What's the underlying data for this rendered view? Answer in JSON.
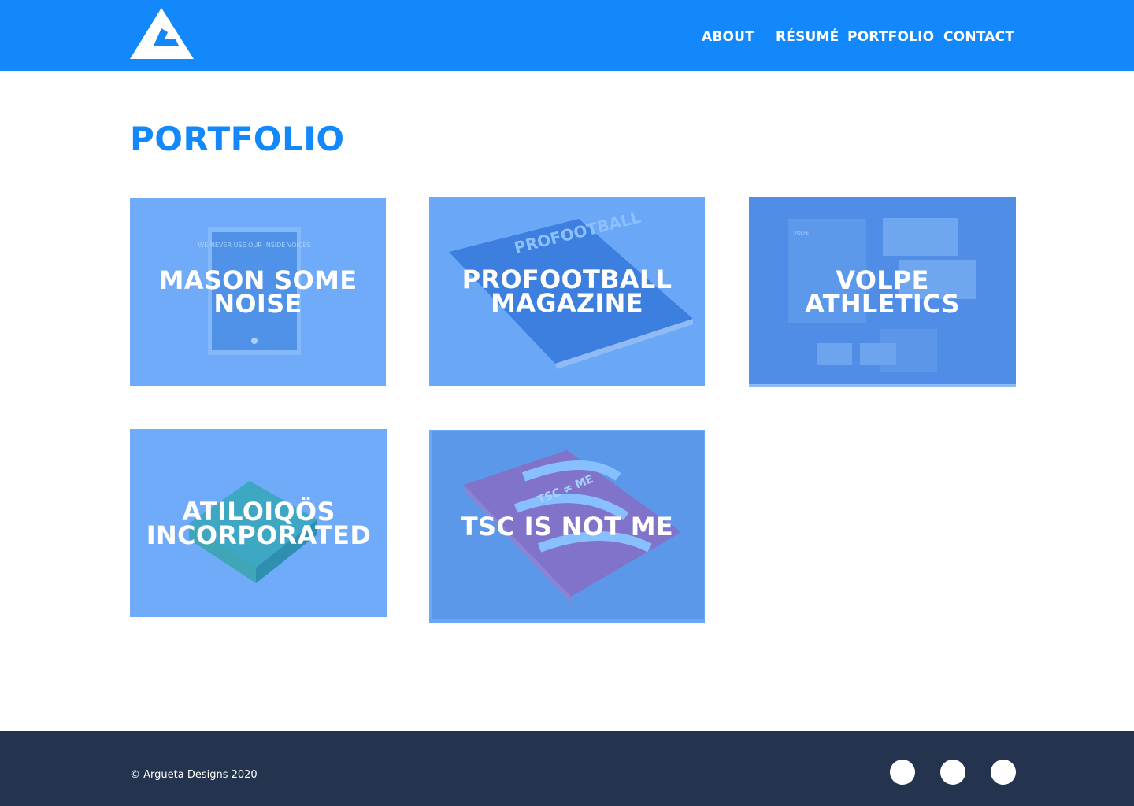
{
  "header": {
    "logo_icon": "triangle-logo-icon",
    "nav": [
      {
        "label": "ABOUT"
      },
      {
        "label": "RÉSUMÉ"
      },
      {
        "label": "PORTFOLIO"
      },
      {
        "label": "CONTACT"
      }
    ]
  },
  "main": {
    "title": "PORTFOLIO",
    "projects": [
      {
        "title": "MASON SOME NOISE",
        "thumb_text": "WE NEVER USE OUR INSIDE VOICES"
      },
      {
        "title": "PROFOOTBALL MAGAZINE",
        "thumb_text": "PROFOOTBALL"
      },
      {
        "title": "VOLPE ATHLETICS",
        "thumb_text": "VOLPE"
      },
      {
        "title": "ATILOIQÖS INCORPORATED"
      },
      {
        "title": "TSC IS NOT ME",
        "thumb_text": "TSC ≠ ME"
      }
    ]
  },
  "footer": {
    "copyright": "© Argueta Designs 2020",
    "social_icons": [
      "social-icon-1",
      "social-icon-2",
      "social-icon-3"
    ]
  },
  "colors": {
    "brand_blue": "#1388fb",
    "footer_navy": "#24344e",
    "card_overlay": "#6aa8f7"
  }
}
